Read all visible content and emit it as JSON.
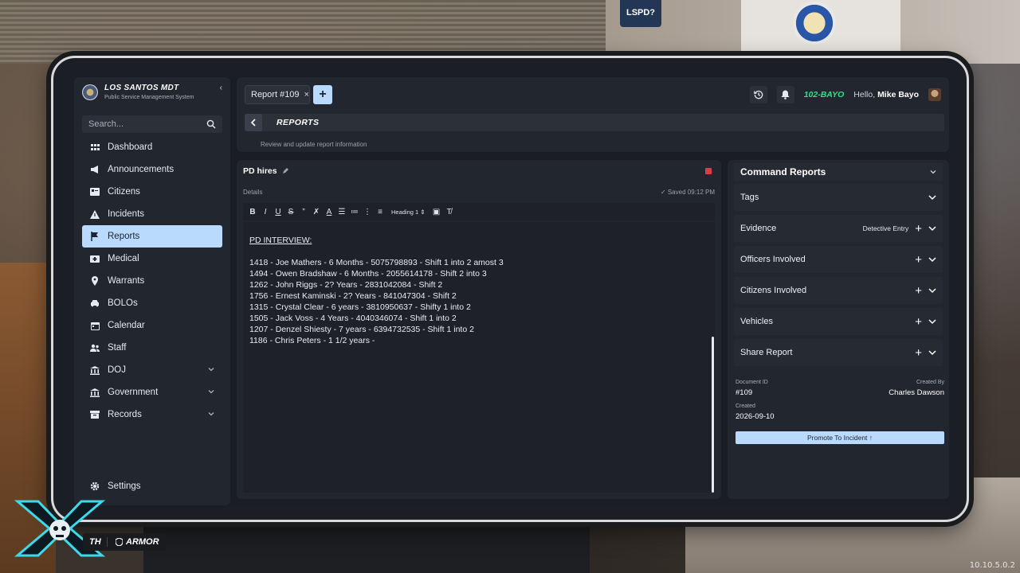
{
  "sidebar": {
    "brand_title": "LOS SANTOS MDT",
    "brand_subtitle": "Public Service Management System",
    "search_placeholder": "Search...",
    "items": [
      {
        "label": "Dashboard"
      },
      {
        "label": "Announcements"
      },
      {
        "label": "Citizens"
      },
      {
        "label": "Incidents"
      },
      {
        "label": "Reports"
      },
      {
        "label": "Medical"
      },
      {
        "label": "Warrants"
      },
      {
        "label": "BOLOs"
      },
      {
        "label": "Calendar"
      },
      {
        "label": "Staff"
      },
      {
        "label": "DOJ"
      },
      {
        "label": "Government"
      },
      {
        "label": "Records"
      }
    ],
    "settings_label": "Settings"
  },
  "topbar": {
    "tab_label": "Report #109",
    "unit": "102-BAYO",
    "hello_prefix": "Hello,",
    "user_name": "Mike Bayo",
    "page_title": "REPORTS",
    "subtitle": "Review and update report information"
  },
  "editor": {
    "title": "PD hires",
    "details_label": "Details",
    "saved_text": "✓ Saved 09:12 PM",
    "heading_select": "Heading 1",
    "content_heading": "PD INTERVIEW:",
    "lines": [
      "1418 - Joe Mathers  - 6 Months - 5075798893 - Shift 1 into 2 amost 3",
      "1494 - Owen Bradshaw - 6 Months - 2055614178 - Shift 2 into 3",
      "1262 - John Riggs - 2? Years - 2831042084 - Shift 2",
      "1756 - Ernest Kaminski - 2? Years - 841047304 - Shift 2",
      "1315 - Crystal Clear - 6 years - 3810950637 - Shifty 1 into 2",
      "1505 - Jack Voss - 4 Years - 4040346074 - Shift 1 into 2",
      "1207 - Denzel Shiesty - 7 years - 6394732535 - Shift 1 into 2",
      "1186 - Chris Peters - 1 1/2 years -"
    ]
  },
  "right_panel": {
    "title": "Command Reports",
    "sections": [
      {
        "name": "Tags"
      },
      {
        "name": "Evidence",
        "badge": "Detective Entry"
      },
      {
        "name": "Officers Involved"
      },
      {
        "name": "Citizens Involved"
      },
      {
        "name": "Vehicles"
      },
      {
        "name": "Share Report"
      }
    ],
    "document_id_label": "Document ID",
    "document_id": "#109",
    "created_by_label": "Created By",
    "created_by": "Charles Dawson",
    "created_label": "Created",
    "created": "2026-09-10",
    "promote_label": "Promote To Incident ↑"
  },
  "hud": {
    "health_label": "TH",
    "armor_label": "ARMOR"
  },
  "version": "10.10.5.0.2",
  "colors": {
    "accent": "#b9dafc",
    "unit_green": "#2ee08a",
    "danger": "#e03a4a",
    "panel": "#22262e"
  }
}
